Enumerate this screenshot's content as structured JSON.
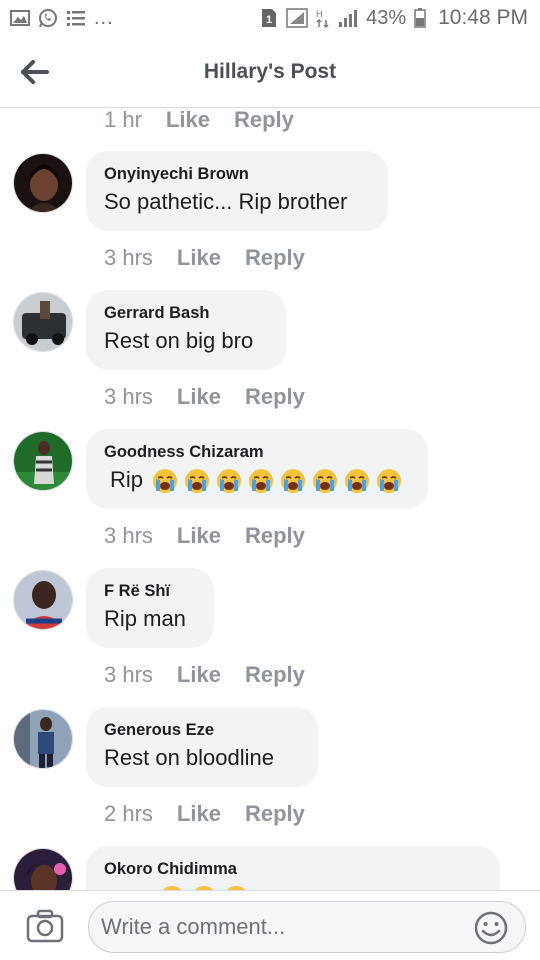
{
  "status_bar": {
    "left_icons": [
      "image-icon",
      "whatsapp-icon",
      "list-icon"
    ],
    "more": "...",
    "sim_badge": "1",
    "battery_percent": "43%",
    "time": "10:48 PM"
  },
  "header": {
    "title": "Hillary's Post"
  },
  "top_meta": {
    "time": "1 hr",
    "like": "Like",
    "reply": "Reply"
  },
  "comments": [
    {
      "author": "Onyinyechi Brown",
      "text": "So pathetic... Rip brother",
      "time": "3 hrs",
      "like": "Like",
      "reply": "Reply"
    },
    {
      "author": "Gerrard Bash",
      "text": "Rest on big bro",
      "time": "3 hrs",
      "like": "Like",
      "reply": "Reply"
    },
    {
      "author": "Goodness Chizaram",
      "text": "Rip",
      "emoji_count": 8,
      "emoji": "loudly-crying-face",
      "time": "3 hrs",
      "like": "Like",
      "reply": "Reply"
    },
    {
      "author": "F Rë Shï",
      "text": "Rip man",
      "time": "3 hrs",
      "like": "Like",
      "reply": "Reply"
    },
    {
      "author": "Generous Eze",
      "text": "Rest on bloodline",
      "time": "2 hrs",
      "like": "Like",
      "reply": "Reply"
    },
    {
      "author": "Okoro Chidimma",
      "text": "",
      "emoji": "grinning-face"
    }
  ],
  "composer": {
    "placeholder": "Write a comment..."
  },
  "colors": {
    "bubble": "#f2f3f5",
    "meta_text": "#90949c",
    "header_text": "#4b4f56",
    "divider": "#dcdde1"
  }
}
